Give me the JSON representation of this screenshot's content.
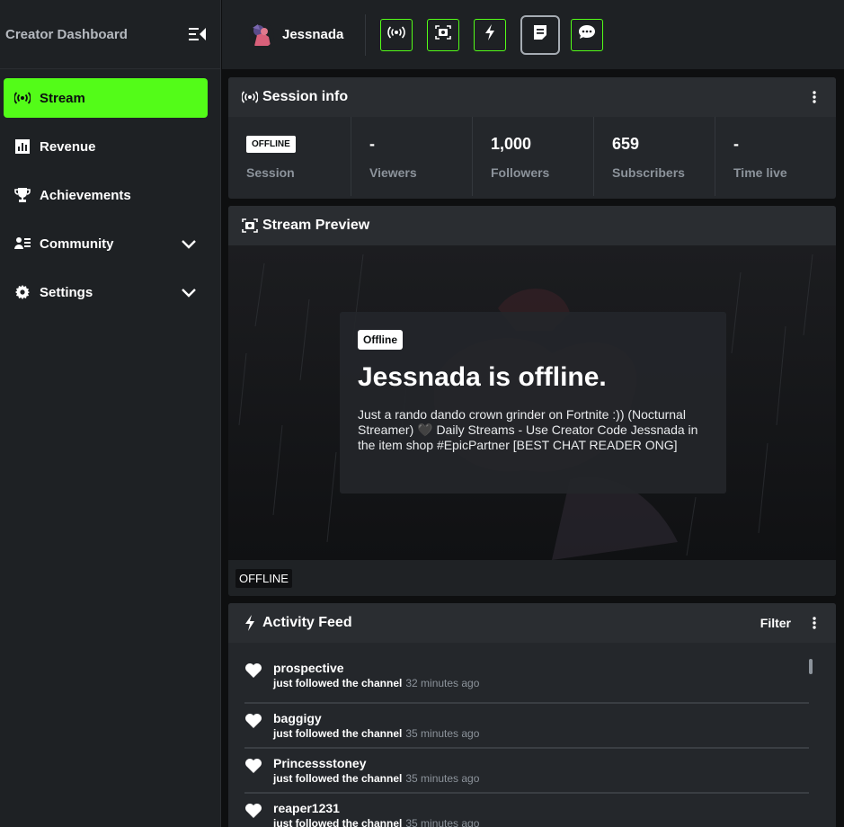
{
  "sidebar": {
    "title": "Creator Dashboard",
    "items": [
      {
        "label": "Stream",
        "icon": "broadcast-icon"
      },
      {
        "label": "Revenue",
        "icon": "chart-icon"
      },
      {
        "label": "Achievements",
        "icon": "trophy-icon"
      },
      {
        "label": "Community",
        "icon": "users-icon"
      },
      {
        "label": "Settings",
        "icon": "gear-icon"
      }
    ]
  },
  "topbar": {
    "channel_name": "Jessnada"
  },
  "session": {
    "title": "Session info",
    "status_badge": "OFFLINE",
    "stats": [
      {
        "value": "",
        "label": "Session"
      },
      {
        "value": "-",
        "label": "Viewers"
      },
      {
        "value": "1,000",
        "label": "Followers"
      },
      {
        "value": "659",
        "label": "Subscribers"
      },
      {
        "value": "-",
        "label": "Time live"
      }
    ]
  },
  "preview": {
    "title": "Stream Preview",
    "badge": "Offline",
    "heading": "Jessnada is offline.",
    "description": "Just a rando dando crown grinder on Fortnite :)) (Nocturnal Streamer) 🖤 Daily Streams - Use Creator Code Jessnada in the item shop #EpicPartner [BEST CHAT READER ONG]",
    "footer_status": "OFFLINE"
  },
  "activity": {
    "title": "Activity Feed",
    "filter_label": "Filter",
    "items": [
      {
        "user": "prospective",
        "action": "just followed the channel",
        "time": "32 minutes ago"
      },
      {
        "user": "baggigy",
        "action": "just followed the channel",
        "time": "35 minutes ago"
      },
      {
        "user": "Princessstoney",
        "action": "just followed the channel",
        "time": "35 minutes ago"
      },
      {
        "user": "reaper1231",
        "action": "just followed the channel",
        "time": "35 minutes ago"
      }
    ]
  },
  "colors": {
    "accent": "#53fc18",
    "background": "#0e0f10",
    "panel": "#24272b",
    "muted_text": "#8c939b"
  }
}
